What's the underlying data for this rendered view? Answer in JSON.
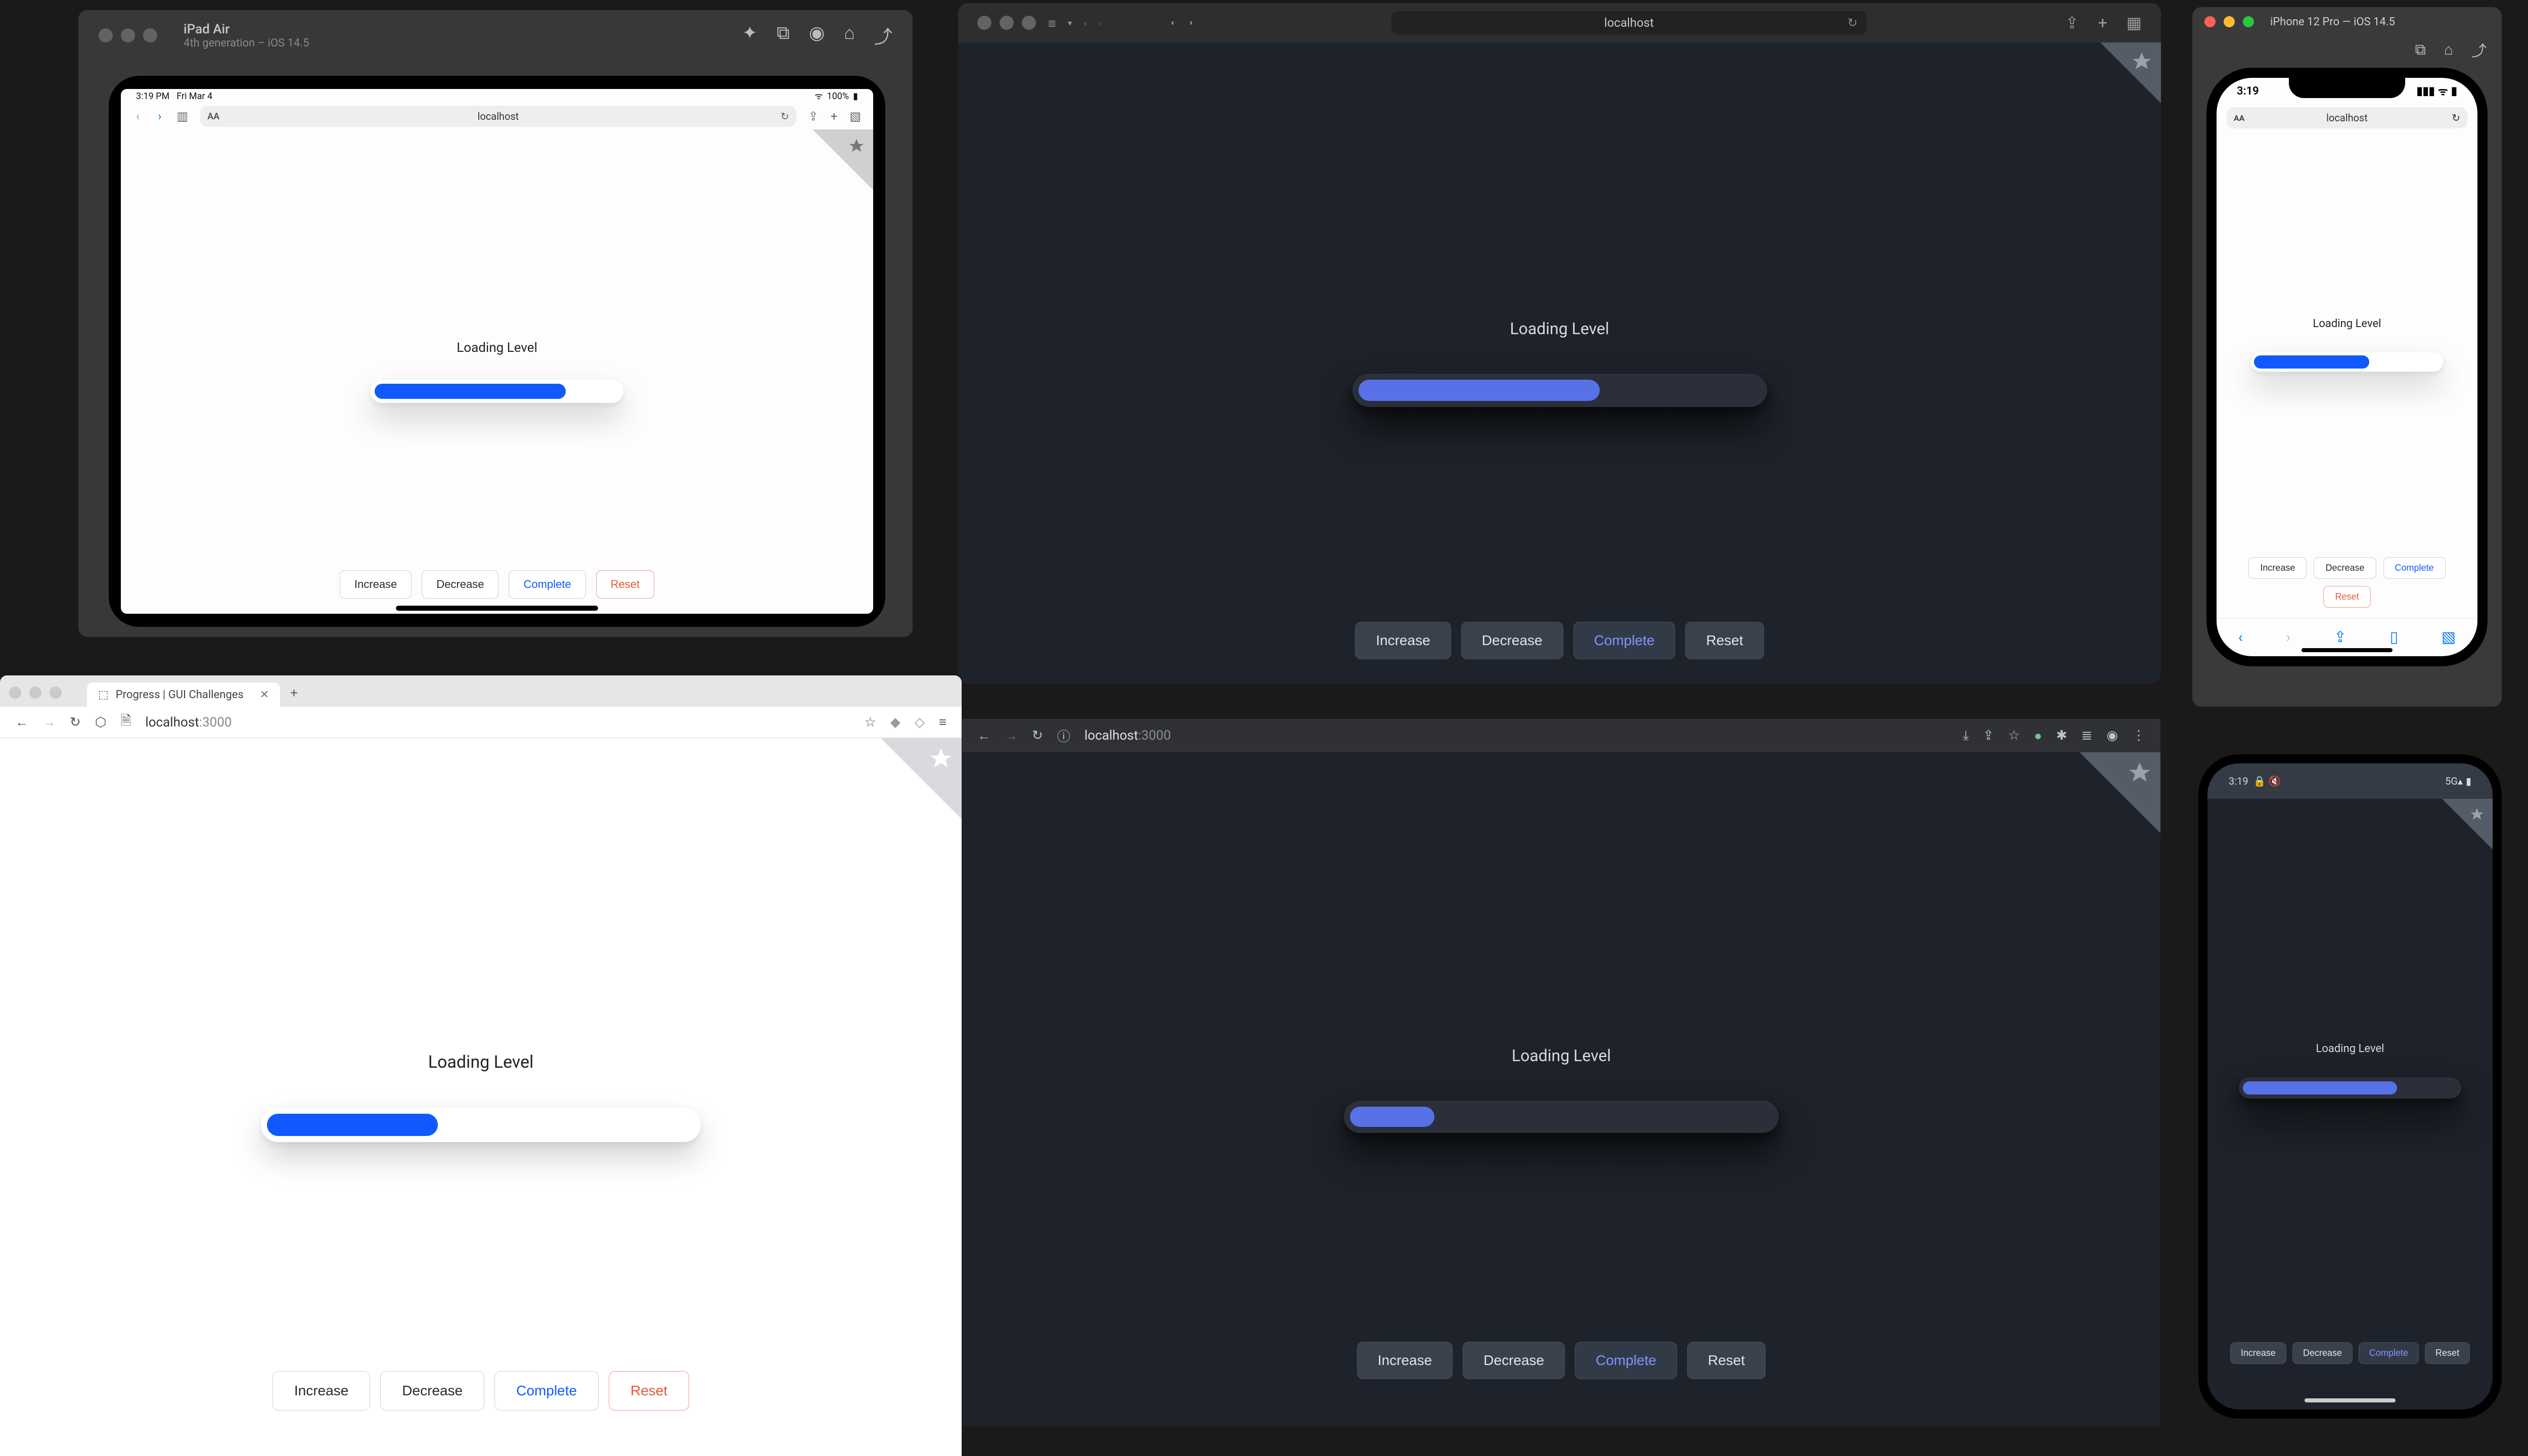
{
  "app": {
    "heading": "Loading Level",
    "url_host": "localhost",
    "url_port": ":3000",
    "buttons": {
      "increase": "Increase",
      "decrease": "Decrease",
      "complete": "Complete",
      "reset": "Reset"
    }
  },
  "progress": {
    "ipad_pct": 78,
    "safari_pct": 60,
    "iphone_pct": 62,
    "brave_pct": 40,
    "chrome_pct": 20,
    "android_pct": 72
  },
  "ipad_sim": {
    "device": "iPad Air",
    "subtitle": "4th generation – iOS 14.5",
    "status_time": "3:19 PM",
    "status_date": "Fri Mar 4",
    "battery": "100%"
  },
  "iphone_sim": {
    "title": "iPhone 12 Pro — iOS 14.5",
    "status_time": "3:19"
  },
  "brave": {
    "tab_title": "Progress | GUI Challenges"
  },
  "android": {
    "status_time": "3:19",
    "status_icon": "🔒 🔇"
  },
  "colors": {
    "accent_light": "#1159ff",
    "accent_dark": "#5771e6",
    "danger": "#e45838"
  }
}
